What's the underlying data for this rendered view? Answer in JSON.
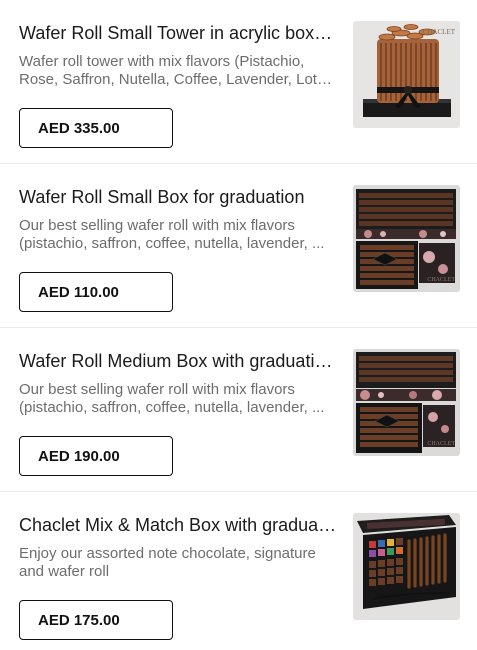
{
  "products": [
    {
      "title": "Wafer Roll Small Tower in acrylic box wit...",
      "description": "Wafer roll tower with mix flavors (Pistachio, Rose, Saffron, Nutella, Coffee, Lavender, Lotus ...",
      "price": "AED 335.00",
      "image_alt": "wafer-roll-tower-photo",
      "brand_mark": "CHACLET"
    },
    {
      "title": "Wafer Roll Small Box for graduation",
      "description": "Our best selling wafer roll with mix flavors (pistachio, saffron, coffee, nutella, lavender, ...",
      "price": "AED 110.00",
      "image_alt": "graduation-box-photo",
      "brand_mark": "CHACLET"
    },
    {
      "title": "Wafer Roll Medium Box with graduation...",
      "description": "Our best selling wafer roll with mix flavors (pistachio, saffron, coffee, nutella, lavender, ...",
      "price": "AED 190.00",
      "image_alt": "medium-graduation-box-photo",
      "brand_mark": "CHACLET"
    },
    {
      "title": "Chaclet Mix & Match Box with graduatio...",
      "description": "Enjoy our assorted note chocolate, signature and wafer roll",
      "price": "AED 175.00",
      "image_alt": "mix-match-box-photo",
      "brand_mark": ""
    }
  ],
  "colors": {
    "title": "#1b1b1b",
    "description": "#6d6d6d",
    "button_border": "#111111",
    "divider": "#ececec"
  }
}
